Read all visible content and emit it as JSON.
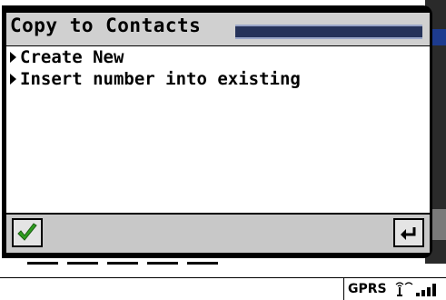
{
  "dialog": {
    "title": "Copy to Contacts",
    "items": [
      {
        "label": "Create New"
      },
      {
        "label": "Insert number into existing"
      }
    ]
  },
  "buttons": {
    "ok_icon": "checkmark-icon",
    "back_icon": "back-arrow-icon"
  },
  "status_bar": {
    "network": "GPRS"
  },
  "colors": {
    "title_bar_bg": "#d0d0d0",
    "title_stripe": "#26335a",
    "check_green": "#2e9e1f"
  }
}
